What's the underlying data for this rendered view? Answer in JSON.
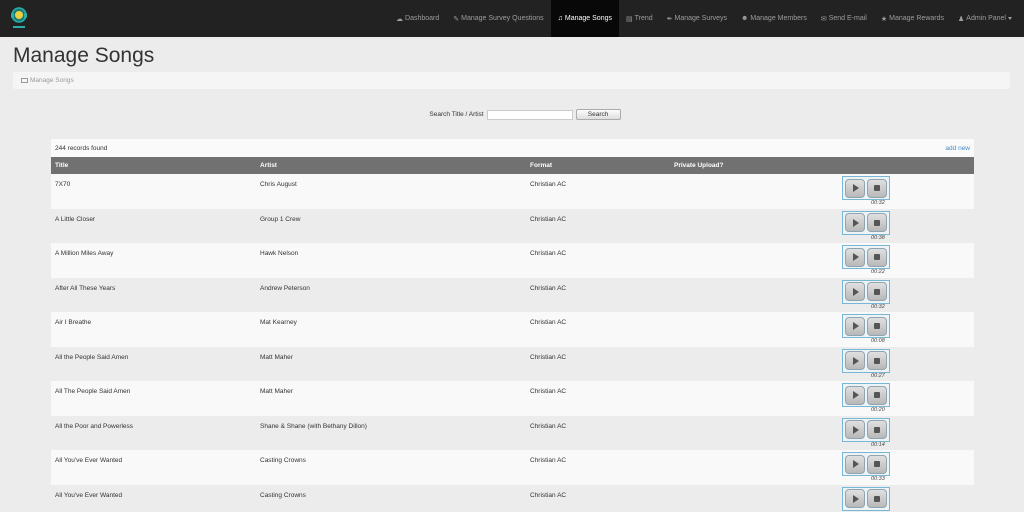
{
  "nav": {
    "items": [
      {
        "icon": "dashboard-icon",
        "glyph": "☁",
        "label": "Dashboard",
        "active": false
      },
      {
        "icon": "edit-icon",
        "glyph": "✎",
        "label": "Manage Survey Questions",
        "active": false
      },
      {
        "icon": "music-icon",
        "glyph": "♫",
        "label": "Manage Songs",
        "active": true
      },
      {
        "icon": "chart-icon",
        "glyph": "▤",
        "label": "Trend",
        "active": false
      },
      {
        "icon": "wrench-icon",
        "glyph": "✒",
        "label": "Manage Surveys",
        "active": false
      },
      {
        "icon": "users-icon",
        "glyph": "☻",
        "label": "Manage Members",
        "active": false
      },
      {
        "icon": "envelope-icon",
        "glyph": "✉",
        "label": "Send E-mail",
        "active": false
      },
      {
        "icon": "star-icon",
        "glyph": "★",
        "label": "Manage Rewards",
        "active": false
      },
      {
        "icon": "user-icon",
        "glyph": "♟",
        "label": "Admin Panel",
        "active": false
      }
    ]
  },
  "page": {
    "title": "Manage Songs",
    "breadcrumb": "Manage Songs"
  },
  "search": {
    "label": "Search Title / Artist",
    "value": "",
    "button": "Search"
  },
  "table": {
    "records": "244 records found",
    "add_new": "add new",
    "headers": [
      "Title",
      "Artist",
      "Format",
      "Private Upload?"
    ],
    "rows": [
      {
        "title": "7X70",
        "artist": "Chris August",
        "format": "Christian AC",
        "duration": "00:32"
      },
      {
        "title": "A Little Closer",
        "artist": "Group 1 Crew",
        "format": "Christian AC",
        "duration": "00:38"
      },
      {
        "title": "A Million Miles Away",
        "artist": "Hawk Nelson",
        "format": "Christian AC",
        "duration": "00:22"
      },
      {
        "title": "After All These Years",
        "artist": "Andrew Peterson",
        "format": "Christian AC",
        "duration": "00:32"
      },
      {
        "title": "Air I Breathe",
        "artist": "Mat Kearney",
        "format": "Christian AC",
        "duration": "00:08"
      },
      {
        "title": "All the People Said Amen",
        "artist": "Matt Maher",
        "format": "Christian AC",
        "duration": "00:27"
      },
      {
        "title": "All The People Said Amen",
        "artist": "Matt Maher",
        "format": "Christian AC",
        "duration": "00:20"
      },
      {
        "title": "All the Poor and Powerless",
        "artist": "Shane & Shane (with Bethany Dillon)",
        "format": "Christian AC",
        "duration": "00:14"
      },
      {
        "title": "All You've Ever Wanted",
        "artist": "Casting Crowns",
        "format": "Christian AC",
        "duration": "00:33"
      },
      {
        "title": "All You've Ever Wanted",
        "artist": "Casting Crowns",
        "format": "Christian AC",
        "duration": ""
      }
    ]
  },
  "colors": {
    "navbar": "#222222",
    "active_nav": "#080808",
    "table_header": "#717171",
    "link": "#428bca",
    "player_border": "#78b6d6"
  }
}
